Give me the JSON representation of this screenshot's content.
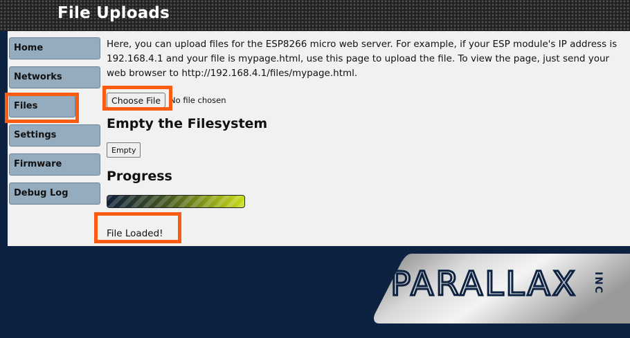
{
  "header": {
    "title": "File Uploads"
  },
  "sidebar": {
    "items": [
      {
        "label": "Home"
      },
      {
        "label": "Networks"
      },
      {
        "label": "Files"
      },
      {
        "label": "Settings"
      },
      {
        "label": "Firmware"
      },
      {
        "label": "Debug Log"
      }
    ],
    "highlighted_item": "Files"
  },
  "content": {
    "intro": "Here, you can upload files for the ESP8266 micro web server. For example, if your ESP module's IP address is 192.168.4.1 and your file is mypage.html, use this page to upload the file. To view the page, just send your web browser to http://192.168.4.1/files/mypage.html.",
    "file_input": {
      "button_label": "Choose File",
      "status_text": "No file chosen"
    },
    "empty_section": {
      "heading": "Empty the Filesystem",
      "button_label": "Empty"
    },
    "progress_section": {
      "heading": "Progress",
      "progress_fraction": 1.0
    },
    "status_message": "File Loaded!"
  },
  "logo": {
    "text": "PARALLAX",
    "suffix": "INC"
  },
  "colors": {
    "background": "#0d2141",
    "panel": "#f1f1f1",
    "nav_button": "#95acbf",
    "highlight": "#fb5c12",
    "progress_start": "#0e1f3a",
    "progress_end": "#c9dd16"
  }
}
